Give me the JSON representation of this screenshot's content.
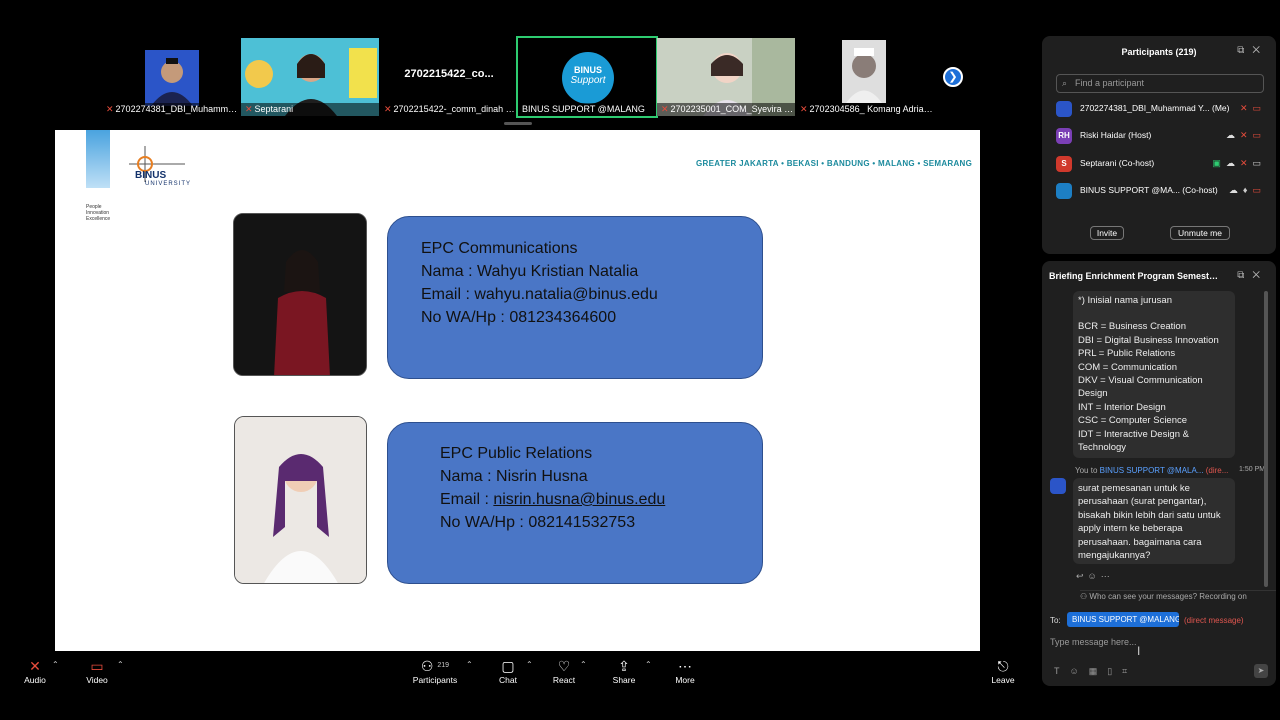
{
  "strip": {
    "tiles": [
      {
        "name": "2702274381_DBI_Muhammad ..."
      },
      {
        "name": "Septarani"
      },
      {
        "big": "2702215422_co...",
        "name": "2702215422-_comm_dinah an..."
      },
      {
        "name": "BINUS SUPPORT @MALANG",
        "logo_line1": "BINUS",
        "logo_line2": "Support"
      },
      {
        "name": "2702235001_COM_Syevira Lin..."
      },
      {
        "name": "2702304586_ Komang Adrian ..."
      }
    ],
    "next_icon": "chevron-right-icon"
  },
  "slide": {
    "logo_word": "BINUS",
    "logo_sub": "UNIVERSITY",
    "tagline": [
      "People",
      "Innovation",
      "Excellence"
    ],
    "cities": "GREATER JAKARTA • BEKASI • BANDUNG • MALANG • SEMARANG",
    "cards": [
      {
        "title": "EPC Communications",
        "name": "Nama : Wahyu Kristian Natalia",
        "email": "Email : wahyu.natalia@binus.edu",
        "phone": "No WA/Hp : 081234364600"
      },
      {
        "title": "EPC Public Relations",
        "name": "Nama : Nisrin Husna",
        "email_prefix": "Email : ",
        "email_link": "nisrin.husna@binus.edu",
        "phone": "No WA/Hp : 082141532753"
      }
    ]
  },
  "participants": {
    "title": "Participants (219)",
    "search_placeholder": "Find a participant",
    "rows": [
      {
        "name": "2702274381_DBI_Muhammad Y... (Me)",
        "avatar": ""
      },
      {
        "name": "Riski Haidar (Host)",
        "avatar": "RH",
        "color": "#7b3fb5"
      },
      {
        "name": "Septarani (Co-host)",
        "avatar": "S",
        "color": "#d0392c"
      },
      {
        "name": "BINUS SUPPORT @MA... (Co-host)",
        "avatar": "",
        "color": "#1d7fc4"
      }
    ],
    "invite": "Invite",
    "unmute": "Unmute me"
  },
  "chat": {
    "title": "Briefing Enrichment Program Semester...",
    "bubble1": [
      "*) Inisial nama jurusan",
      "",
      "BCR = Business Creation",
      "DBI = Digital Business Innovation",
      "PRL = Public Relations",
      "COM = Communication",
      "DKV = Visual Communication",
      "Design",
      "INT = Interior Design",
      "CSC = Computer Science",
      "IDT = Interactive Design &",
      "Technology"
    ],
    "meta_you": "You to ",
    "meta_target": "BINUS SUPPORT @MALA...",
    "meta_direct": "(dire...",
    "meta_time": "1:50 PM",
    "bubble2": [
      "surat pemesanan untuk ke",
      "perusahaan (surat pengantar),",
      "bisakah bikin lebih dari satu untuk",
      "apply intern  ke beberapa",
      "perusahaan. bagaimana cara",
      "mengajukannya?"
    ],
    "visibility": "Who can see your messages? Recording on",
    "to_label": "To:",
    "to_target": "BINUS SUPPORT @MALANG ⌄",
    "to_direct": "(direct message)",
    "input_placeholder": "Type message here..."
  },
  "toolbar": {
    "audio": "Audio",
    "video": "Video",
    "participants": "Participants",
    "participants_count": "219",
    "chat": "Chat",
    "react": "React",
    "share": "Share",
    "more": "More",
    "leave": "Leave"
  },
  "colors": {
    "card_fill": "#4a76c6",
    "active_tile": "#2ecc71",
    "accent_blue": "#1d6fd8",
    "muted_red": "#e74c3c"
  }
}
